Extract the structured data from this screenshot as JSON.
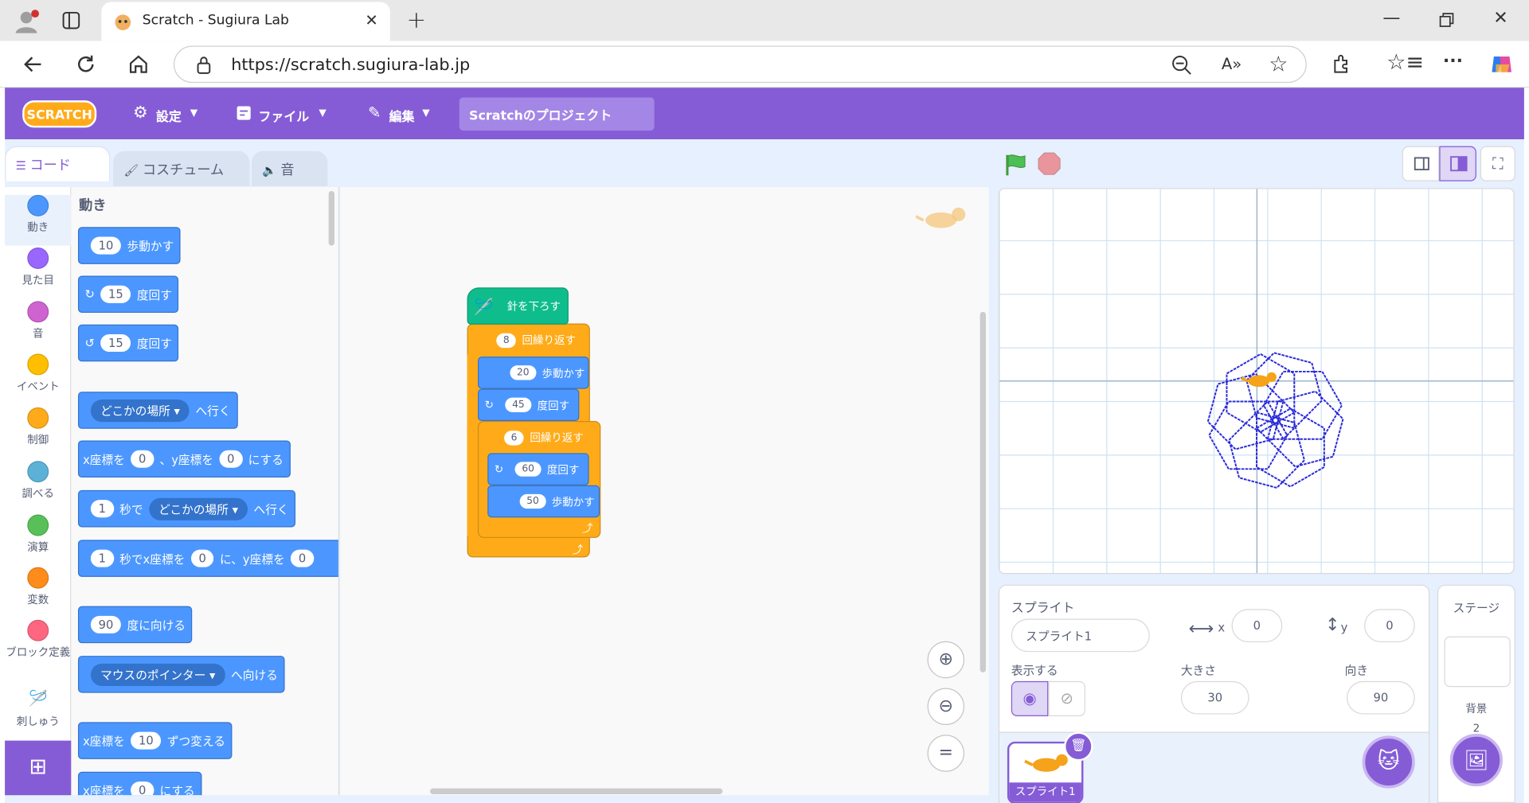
{
  "browser": {
    "tab_title": "Scratch - Sugiura Lab",
    "url": "https://scratch.sugiura-lab.jp",
    "icons": [
      "profile-icon",
      "tab-actions-icon",
      "close-icon",
      "new-tab-icon",
      "minimize-icon",
      "restore-icon",
      "close-window-icon",
      "back-icon",
      "refresh-icon",
      "home-icon",
      "site-info-icon",
      "zoom-out-icon",
      "read-aloud-icon",
      "favorite-icon",
      "extensions-icon",
      "favorites-icon",
      "more-icon",
      "copilot-icon"
    ]
  },
  "menubar": {
    "logo": "SCRATCH",
    "settings": "設定",
    "file": "ファイル",
    "edit": "編集",
    "project_title": "Scratchのプロジェクト",
    "color": "#855cd6"
  },
  "editor_tabs": {
    "code": "コード",
    "costume": "コスチューム",
    "sound": "音"
  },
  "categories": [
    {
      "label": "動き",
      "color": "#4c97ff"
    },
    {
      "label": "見た目",
      "color": "#9966ff"
    },
    {
      "label": "音",
      "color": "#cf63cf"
    },
    {
      "label": "イベント",
      "color": "#ffbf00"
    },
    {
      "label": "制御",
      "color": "#ffab19"
    },
    {
      "label": "調べる",
      "color": "#5cb1d6"
    },
    {
      "label": "演算",
      "color": "#59c059"
    },
    {
      "label": "変数",
      "color": "#ff8c1a"
    },
    {
      "label": "ブロック定義",
      "color": "#ff6680"
    },
    {
      "label": "刺しゅう",
      "color": "#ffffff"
    }
  ],
  "palette": {
    "heading": "動き",
    "b1": {
      "num": "10",
      "text": "歩動かす"
    },
    "b2": {
      "num": "15",
      "text": "度回す"
    },
    "b3": {
      "num": "15",
      "text": "度回す"
    },
    "b4": {
      "dd": "どこかの場所",
      "text": "へ行く"
    },
    "b5": {
      "t1": "x座標を",
      "n1": "0",
      "t2": "、y座標を",
      "n2": "0",
      "t3": "にする"
    },
    "b6": {
      "n1": "1",
      "t1": "秒で",
      "dd": "どこかの場所",
      "t2": "へ行く"
    },
    "b7": {
      "n1": "1",
      "t1": "秒でx座標を",
      "n2": "0",
      "t2": "に、y座標を",
      "n3": "0"
    },
    "b8": {
      "num": "90",
      "text": "度に向ける"
    },
    "b9": {
      "dd": "マウスのポインター",
      "text": "へ向ける"
    },
    "b10": {
      "t1": "x座標を",
      "num": "10",
      "t2": "ずつ変える"
    },
    "b11": {
      "t1": "x座標を",
      "num": "0",
      "t2": "にする"
    }
  },
  "script": {
    "hat": "針を下ろす",
    "repeat1": {
      "num": "8",
      "text": "回繰り返す"
    },
    "move1": {
      "num": "20",
      "text": "歩動かす"
    },
    "turn1": {
      "num": "45",
      "text": "度回す"
    },
    "repeat2": {
      "num": "6",
      "text": "回繰り返す"
    },
    "turn2": {
      "num": "60",
      "text": "度回す"
    },
    "move2": {
      "num": "50",
      "text": "歩動かす"
    }
  },
  "sprite_info": {
    "label": "スプライト",
    "name": "スプライト1",
    "x_label": "x",
    "x": "0",
    "y_label": "y",
    "y": "0",
    "show_label": "表示する",
    "size_label": "大きさ",
    "size": "30",
    "direction_label": "向き",
    "direction": "90",
    "thumb_name": "スプライト1"
  },
  "stage_panel": {
    "title": "ステージ",
    "backdrop_label": "背景",
    "backdrop_count": "2"
  },
  "colors": {
    "motion": "#4c97ff",
    "control": "#ffab19",
    "pen_line": "#2a2ad9",
    "hat": "#0fbd8c"
  }
}
